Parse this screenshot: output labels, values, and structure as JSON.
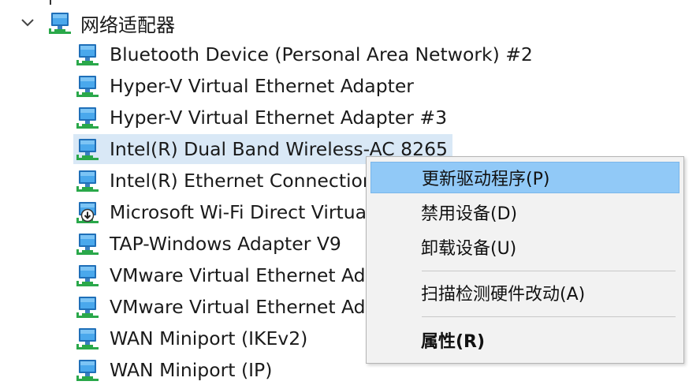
{
  "tree": {
    "category": {
      "label": "网络适配器",
      "icon": "network-adapter-icon",
      "expanded": true
    },
    "devices": [
      {
        "label": "Bluetooth Device (Personal Area Network) #2",
        "icon": "network-adapter-icon"
      },
      {
        "label": "Hyper-V Virtual Ethernet Adapter",
        "icon": "network-adapter-icon"
      },
      {
        "label": "Hyper-V Virtual Ethernet Adapter #3",
        "icon": "network-adapter-icon"
      },
      {
        "label": "Intel(R) Dual Band Wireless-AC 8265",
        "icon": "network-adapter-icon",
        "selected": true
      },
      {
        "label": "Intel(R) Ethernet Connection",
        "icon": "network-adapter-icon"
      },
      {
        "label": "Microsoft Wi-Fi Direct Virtua",
        "icon": "network-adapter-disabled-icon"
      },
      {
        "label": "TAP-Windows Adapter V9",
        "icon": "network-adapter-icon"
      },
      {
        "label": "VMware Virtual Ethernet Ada",
        "icon": "network-adapter-icon"
      },
      {
        "label": "VMware Virtual Ethernet Ada",
        "icon": "network-adapter-icon"
      },
      {
        "label": "WAN Miniport (IKEv2)",
        "icon": "network-adapter-icon"
      },
      {
        "label": "WAN Miniport (IP)",
        "icon": "network-adapter-icon"
      }
    ]
  },
  "context_menu": {
    "items": [
      {
        "label": "更新驱动程序(P)",
        "highlighted": true
      },
      {
        "label": "禁用设备(D)"
      },
      {
        "label": "卸载设备(U)"
      },
      {
        "label": "扫描检测硬件改动(A)"
      },
      {
        "label": "属性(R)",
        "bold": true
      }
    ]
  },
  "colors": {
    "selection": "#d9e8f6",
    "menu_highlight": "#91c9f7",
    "menu_background": "#f2f2f2",
    "icon_screen": "#2a8ad4",
    "icon_cable": "#2aa84a"
  }
}
